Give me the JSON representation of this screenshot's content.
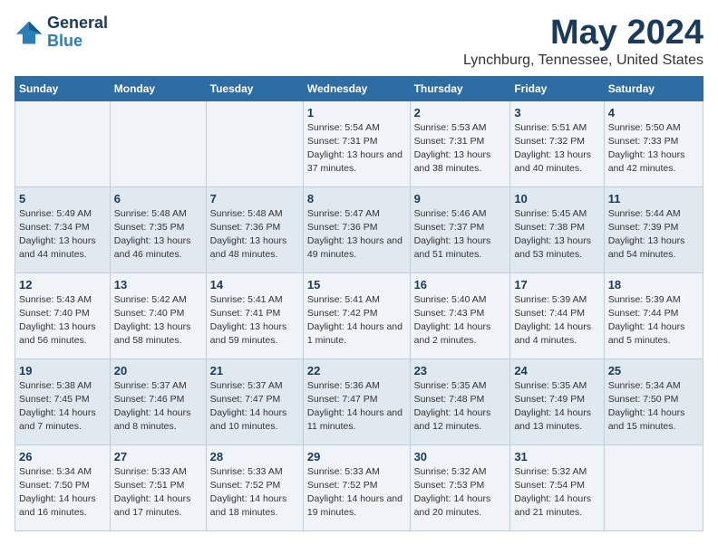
{
  "logo": {
    "line1": "General",
    "line2": "Blue"
  },
  "title": "May 2024",
  "subtitle": "Lynchburg, Tennessee, United States",
  "days_of_week": [
    "Sunday",
    "Monday",
    "Tuesday",
    "Wednesday",
    "Thursday",
    "Friday",
    "Saturday"
  ],
  "weeks": [
    [
      {
        "day": "",
        "info": ""
      },
      {
        "day": "",
        "info": ""
      },
      {
        "day": "",
        "info": ""
      },
      {
        "day": "1",
        "info": "Sunrise: 5:54 AM\nSunset: 7:31 PM\nDaylight: 13 hours and 37 minutes."
      },
      {
        "day": "2",
        "info": "Sunrise: 5:53 AM\nSunset: 7:31 PM\nDaylight: 13 hours and 38 minutes."
      },
      {
        "day": "3",
        "info": "Sunrise: 5:51 AM\nSunset: 7:32 PM\nDaylight: 13 hours and 40 minutes."
      },
      {
        "day": "4",
        "info": "Sunrise: 5:50 AM\nSunset: 7:33 PM\nDaylight: 13 hours and 42 minutes."
      }
    ],
    [
      {
        "day": "5",
        "info": "Sunrise: 5:49 AM\nSunset: 7:34 PM\nDaylight: 13 hours and 44 minutes."
      },
      {
        "day": "6",
        "info": "Sunrise: 5:48 AM\nSunset: 7:35 PM\nDaylight: 13 hours and 46 minutes."
      },
      {
        "day": "7",
        "info": "Sunrise: 5:48 AM\nSunset: 7:36 PM\nDaylight: 13 hours and 48 minutes."
      },
      {
        "day": "8",
        "info": "Sunrise: 5:47 AM\nSunset: 7:36 PM\nDaylight: 13 hours and 49 minutes."
      },
      {
        "day": "9",
        "info": "Sunrise: 5:46 AM\nSunset: 7:37 PM\nDaylight: 13 hours and 51 minutes."
      },
      {
        "day": "10",
        "info": "Sunrise: 5:45 AM\nSunset: 7:38 PM\nDaylight: 13 hours and 53 minutes."
      },
      {
        "day": "11",
        "info": "Sunrise: 5:44 AM\nSunset: 7:39 PM\nDaylight: 13 hours and 54 minutes."
      }
    ],
    [
      {
        "day": "12",
        "info": "Sunrise: 5:43 AM\nSunset: 7:40 PM\nDaylight: 13 hours and 56 minutes."
      },
      {
        "day": "13",
        "info": "Sunrise: 5:42 AM\nSunset: 7:40 PM\nDaylight: 13 hours and 58 minutes."
      },
      {
        "day": "14",
        "info": "Sunrise: 5:41 AM\nSunset: 7:41 PM\nDaylight: 13 hours and 59 minutes."
      },
      {
        "day": "15",
        "info": "Sunrise: 5:41 AM\nSunset: 7:42 PM\nDaylight: 14 hours and 1 minute."
      },
      {
        "day": "16",
        "info": "Sunrise: 5:40 AM\nSunset: 7:43 PM\nDaylight: 14 hours and 2 minutes."
      },
      {
        "day": "17",
        "info": "Sunrise: 5:39 AM\nSunset: 7:44 PM\nDaylight: 14 hours and 4 minutes."
      },
      {
        "day": "18",
        "info": "Sunrise: 5:39 AM\nSunset: 7:44 PM\nDaylight: 14 hours and 5 minutes."
      }
    ],
    [
      {
        "day": "19",
        "info": "Sunrise: 5:38 AM\nSunset: 7:45 PM\nDaylight: 14 hours and 7 minutes."
      },
      {
        "day": "20",
        "info": "Sunrise: 5:37 AM\nSunset: 7:46 PM\nDaylight: 14 hours and 8 minutes."
      },
      {
        "day": "21",
        "info": "Sunrise: 5:37 AM\nSunset: 7:47 PM\nDaylight: 14 hours and 10 minutes."
      },
      {
        "day": "22",
        "info": "Sunrise: 5:36 AM\nSunset: 7:47 PM\nDaylight: 14 hours and 11 minutes."
      },
      {
        "day": "23",
        "info": "Sunrise: 5:35 AM\nSunset: 7:48 PM\nDaylight: 14 hours and 12 minutes."
      },
      {
        "day": "24",
        "info": "Sunrise: 5:35 AM\nSunset: 7:49 PM\nDaylight: 14 hours and 13 minutes."
      },
      {
        "day": "25",
        "info": "Sunrise: 5:34 AM\nSunset: 7:50 PM\nDaylight: 14 hours and 15 minutes."
      }
    ],
    [
      {
        "day": "26",
        "info": "Sunrise: 5:34 AM\nSunset: 7:50 PM\nDaylight: 14 hours and 16 minutes."
      },
      {
        "day": "27",
        "info": "Sunrise: 5:33 AM\nSunset: 7:51 PM\nDaylight: 14 hours and 17 minutes."
      },
      {
        "day": "28",
        "info": "Sunrise: 5:33 AM\nSunset: 7:52 PM\nDaylight: 14 hours and 18 minutes."
      },
      {
        "day": "29",
        "info": "Sunrise: 5:33 AM\nSunset: 7:52 PM\nDaylight: 14 hours and 19 minutes."
      },
      {
        "day": "30",
        "info": "Sunrise: 5:32 AM\nSunset: 7:53 PM\nDaylight: 14 hours and 20 minutes."
      },
      {
        "day": "31",
        "info": "Sunrise: 5:32 AM\nSunset: 7:54 PM\nDaylight: 14 hours and 21 minutes."
      },
      {
        "day": "",
        "info": ""
      }
    ]
  ]
}
